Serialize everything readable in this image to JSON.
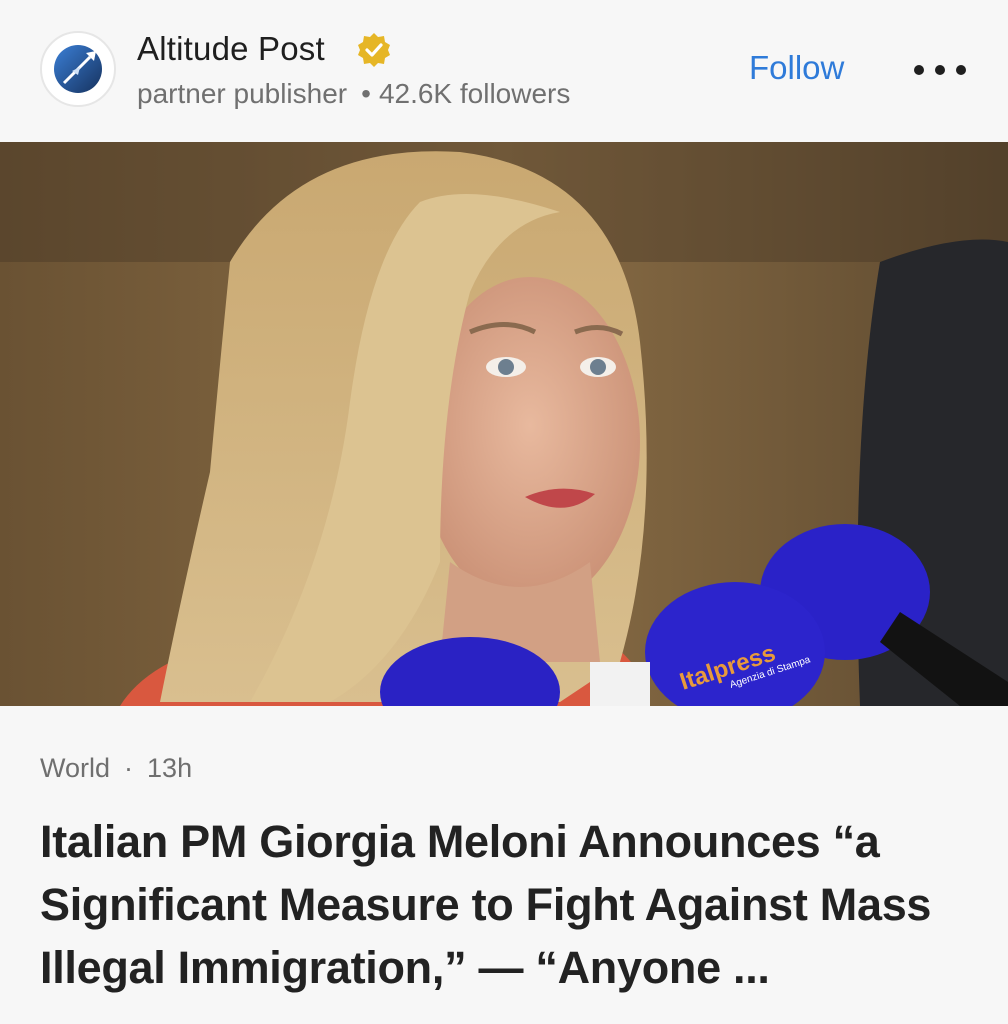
{
  "publisher": {
    "name": "Altitude Post",
    "subtitle": "partner publisher",
    "separator": "•",
    "followers": "42.6K followers",
    "logo_icon": "plane-globe-icon",
    "badge_icon": "verified-badge-icon"
  },
  "actions": {
    "follow_label": "Follow",
    "more_icon": "more-dots-icon"
  },
  "article": {
    "image_icon": "news-photo",
    "category": "World",
    "separator": "·",
    "age": "13h",
    "headline": "Italian PM Giorgia Meloni Announces “a Significant Measure to Fight Against Mass Illegal Immigration,” — “Anyone ..."
  },
  "photo_text": {
    "mic_brand": "Italpress",
    "mic_sub": "Agenzia di Stampa"
  },
  "colors": {
    "accent": "#2f7bd9",
    "badge": "#e6b626",
    "background": "#f7f7f7",
    "text": "#222222"
  }
}
